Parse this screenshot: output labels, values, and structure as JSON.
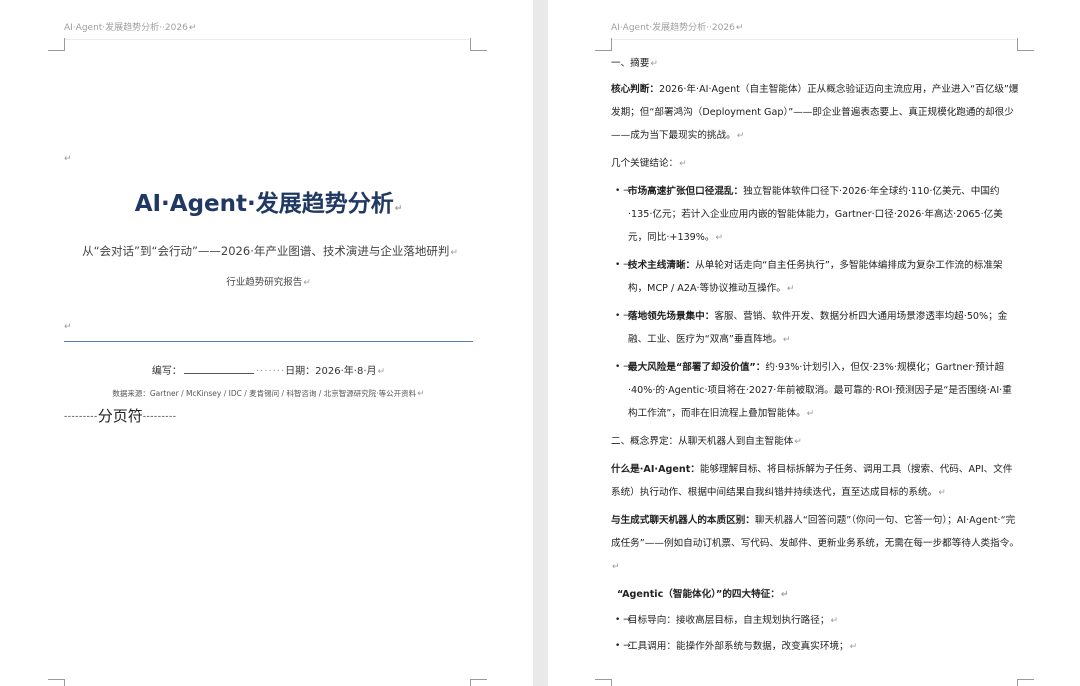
{
  "document": {
    "running_header": "AI·Agent·发展趋势分析··2026"
  },
  "cover": {
    "title": "AI·Agent·发展趋势分析",
    "subtitle": "从“会对话”到“会行动”——2026·年产业图谱、技术演进与企业落地研判",
    "organization": "行业趋势研究报告",
    "author_label": "编写：",
    "date_text": "日期：2026·年·8·月",
    "source_text": "数据来源：Gartner / McKinsey / IDC / 麦肯锡问 / 科智咨询 / 北京智源研究院·等公开资料",
    "page_break_label": "分页符"
  },
  "content": {
    "section1_heading": "一、摘要",
    "core_label": "核心判断：",
    "core_text": "2026·年·AI·Agent（自主智能体）正从概念验证迈向主流应用，产业进入“百亿级”爆发期；但“部署鸿沟（Deployment Gap）”——即企业普遍表态要上、真正规模化跑通的却很少——成为当下最现实的挑战。",
    "conclusions_heading": "几个关键结论：",
    "bullets": [
      {
        "lead": "市场高速扩张但口径混乱：",
        "text": "独立智能体软件口径下·2026·年全球约·110·亿美元、中国约·135·亿元；若计入企业应用内嵌的智能体能力，Gartner·口径·2026·年高达·2065·亿美元，同比·+139%。"
      },
      {
        "lead": "技术主线清晰：",
        "text": "从单轮对话走向“自主任务执行”，多智能体编排成为复杂工作流的标准架构，MCP / A2A·等协议推动互操作。"
      },
      {
        "lead": "落地领先场景集中：",
        "text": "客服、营销、软件开发、数据分析四大通用场景渗透率均超·50%；金融、工业、医疗为“双高”垂直阵地。"
      },
      {
        "lead": "最大风险是“部署了却没价值”：",
        "text": "约·93%·计划引入，但仅·23%·规模化；Gartner·预计超·40%·的·Agentic·项目将在·2027·年前被取消。最可靠的·ROI·预测因子是“是否围绕·AI·重构工作流”，而非在旧流程上叠加智能体。"
      }
    ],
    "section2_heading": "二、概念界定：从聊天机器人到自主智能体",
    "what_is_label": "什么是·AI·Agent：",
    "what_is_text": "能够理解目标、将目标拆解为子任务、调用工具（搜索、代码、API、文件系统）执行动作、根据中间结果自我纠错并持续迭代，直至达成目标的系统。",
    "diff_label": "与生成式聊天机器人的本质区别：",
    "diff_text": "聊天机器人“回答问题”（你问一句、它答一句）；AI·Agent·“完成任务”——例如自动订机票、写代码、发邮件、更新业务系统，无需在每一步都等待人类指令。",
    "features_heading": "“Agentic（智能体化）”的四大特征：",
    "features": [
      "目标导向：接收高层目标，自主规划执行路径；",
      "工具调用：能操作外部系统与数据，改变真实环境；"
    ]
  },
  "symbols": {
    "paragraph_mark": "↵",
    "bullet_glyph": "• →",
    "leader_dots": "·······",
    "break_dashes": "---------"
  }
}
